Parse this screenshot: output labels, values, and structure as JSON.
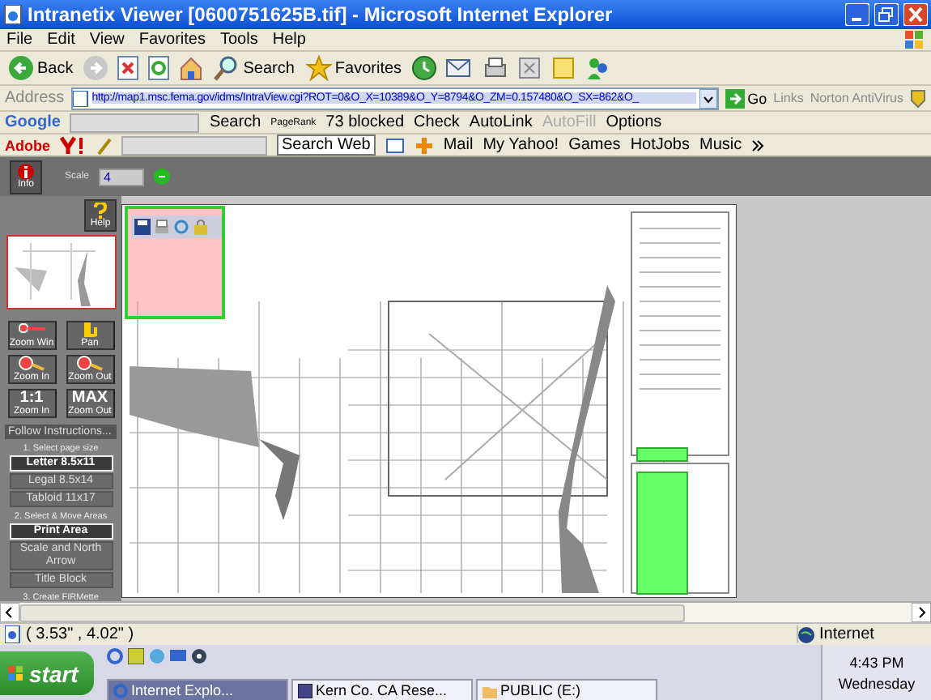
{
  "window": {
    "title": "Intranetix Viewer [0600751625B.tif] - Microsoft Internet Explorer"
  },
  "menu": [
    "File",
    "Edit",
    "View",
    "Favorites",
    "Tools",
    "Help"
  ],
  "toolbar": [
    "Back",
    "Search",
    "Favorites"
  ],
  "address": {
    "label": "Address",
    "value": "http://map1.msc.fema.gov/idms/IntraView.cgi?ROT=0&O_X=10389&O_Y=8794&O_ZM=0.157480&O_SX=862&O_",
    "go": "Go",
    "links": "Links",
    "extra": "Norton AntiVirus"
  },
  "google_bar": {
    "logo": "Google",
    "items": [
      {
        "label": "Search",
        "disabled": false
      },
      {
        "label": "PageRank",
        "disabled": false
      },
      {
        "label": "73 blocked",
        "disabled": false
      },
      {
        "label": "Check",
        "disabled": false
      },
      {
        "label": "AutoLink",
        "disabled": false
      },
      {
        "label": "AutoFill",
        "disabled": true
      },
      {
        "label": "Options",
        "disabled": false
      }
    ]
  },
  "yahoo_bar": {
    "adobe": "Adobe",
    "search": "Search Web",
    "items": [
      "Mail",
      "My Yahoo!",
      "Games",
      "HotJobs",
      "Music"
    ]
  },
  "viewer": {
    "info": "Info",
    "scale_label": "Scale",
    "scale_value": "4",
    "help": "Help",
    "tools": [
      {
        "label": "Zoom Win"
      },
      {
        "label": "Pan"
      },
      {
        "label": "Zoom In"
      },
      {
        "label": "Zoom Out"
      },
      {
        "big": "1:1",
        "label": "Zoom In"
      },
      {
        "big": "MAX",
        "label": "Zoom Out"
      }
    ],
    "instructions": "Follow Instructions...",
    "step1": "1. Select page size",
    "sizes": [
      {
        "label": "Letter 8.5x11",
        "selected": true
      },
      {
        "label": "Legal 8.5x14",
        "selected": false
      },
      {
        "label": "Tabloid 11x17",
        "selected": false
      }
    ],
    "step2": "2. Select & Move Areas",
    "areas": [
      {
        "label": "Print Area",
        "selected": true
      },
      {
        "label": "Scale and North Arrow",
        "selected": false
      },
      {
        "label": "Title Block",
        "selected": false
      }
    ],
    "step3": "3. Create FIRMette"
  },
  "status_bar": {
    "coords": "( 3.53\" , 4.02\" )",
    "zone": "Internet"
  },
  "taskbar": {
    "start": "start",
    "tasks": [
      {
        "label": "Internet Explo...",
        "selected": true
      },
      {
        "label": "Kern Co. CA Rese...",
        "selected": false
      },
      {
        "label": "PUBLIC (E:)",
        "selected": false
      }
    ],
    "time": "4:43 PM",
    "day": "Wednesday"
  }
}
